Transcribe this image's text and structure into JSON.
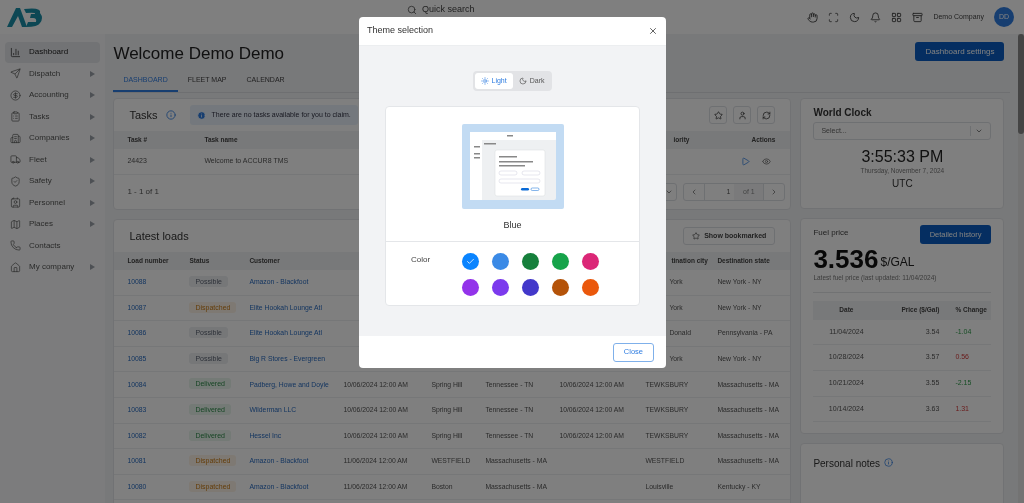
{
  "topbar": {
    "search_placeholder": "Quick search",
    "company": "Demo Company",
    "avatar": "DD"
  },
  "sidebar": {
    "items": [
      {
        "label": "Dashboard",
        "selected": true,
        "has_submenu": false
      },
      {
        "label": "Dispatch",
        "selected": false,
        "has_submenu": true
      },
      {
        "label": "Accounting",
        "selected": false,
        "has_submenu": true
      },
      {
        "label": "Tasks",
        "selected": false,
        "has_submenu": true
      },
      {
        "label": "Companies",
        "selected": false,
        "has_submenu": true
      },
      {
        "label": "Fleet",
        "selected": false,
        "has_submenu": true
      },
      {
        "label": "Safety",
        "selected": false,
        "has_submenu": true
      },
      {
        "label": "Personnel",
        "selected": false,
        "has_submenu": true
      },
      {
        "label": "Places",
        "selected": false,
        "has_submenu": true
      },
      {
        "label": "Contacts",
        "selected": false,
        "has_submenu": false
      },
      {
        "label": "My company",
        "selected": false,
        "has_submenu": true
      }
    ]
  },
  "page": {
    "title": "Welcome Demo Demo",
    "settings_button": "Dashboard settings",
    "tabs": [
      {
        "label": "DASHBOARD",
        "selected": true
      },
      {
        "label": "FLEET MAP",
        "selected": false
      },
      {
        "label": "CALENDAR",
        "selected": false
      }
    ]
  },
  "tasks": {
    "title": "Tasks",
    "alert": "There are no tasks available for you to claim.",
    "columns": [
      "Task #",
      "Task name"
    ],
    "columns_right": [
      "iority",
      "Actions"
    ],
    "rows": [
      {
        "number": "24423",
        "name": "Welcome to ACCUR8 TMS"
      }
    ],
    "range": "1 - 1 of 1",
    "page": "1",
    "page_of": "of 1"
  },
  "loads": {
    "title": "Latest loads",
    "bookmark_button": "Show bookmarked",
    "columns": [
      "Load number",
      "Status",
      "Customer"
    ],
    "columns_right": [
      "tination city",
      "Destination state"
    ],
    "rows": [
      {
        "load": "10088",
        "status": "Possible",
        "kind": "possible",
        "customer": "Amazon - Blackfoot",
        "dest_city": "York",
        "dest_state": "New York - NY"
      },
      {
        "load": "10087",
        "status": "Dispatched",
        "kind": "dispatched",
        "customer": "Elite Hookah Lounge Atl",
        "dest_city": "York",
        "dest_state": "New York - NY"
      },
      {
        "load": "10086",
        "status": "Possible",
        "kind": "possible",
        "customer": "Elite Hookah Lounge Atl",
        "dest_city": "Donald",
        "dest_state": "Pennsylvania - PA"
      },
      {
        "load": "10085",
        "status": "Possible",
        "kind": "possible",
        "customer": "Big R Stores - Evergreen",
        "dest_city": "York",
        "dest_state": "New York - NY"
      },
      {
        "load": "10084",
        "status": "Delivered",
        "kind": "delivered",
        "customer": "Padberg, Howe and Doyle",
        "pickup": "10/06/2024 12:00 AM",
        "origin_city": "Spring Hill",
        "origin_state": "Tennessee - TN",
        "delivery": "10/06/2024 12:00 AM",
        "dest_city": "TEWKSBURY",
        "dest_state": "Massachusetts - MA"
      },
      {
        "load": "10083",
        "status": "Delivered",
        "kind": "delivered",
        "customer": "Wilderman LLC",
        "pickup": "10/06/2024 12:00 AM",
        "origin_city": "Spring Hill",
        "origin_state": "Tennessee - TN",
        "delivery": "10/06/2024 12:00 AM",
        "dest_city": "TEWKSBURY",
        "dest_state": "Massachusetts - MA"
      },
      {
        "load": "10082",
        "status": "Delivered",
        "kind": "delivered",
        "customer": "Hessel Inc",
        "pickup": "10/06/2024 12:00 AM",
        "origin_city": "Spring Hill",
        "origin_state": "Tennessee - TN",
        "delivery": "10/06/2024 12:00 AM",
        "dest_city": "TEWKSBURY",
        "dest_state": "Massachusetts - MA"
      },
      {
        "load": "10081",
        "status": "Dispatched",
        "kind": "dispatched",
        "customer": "Amazon - Blackfoot",
        "pickup": "11/06/2024 12:00 AM",
        "origin_city": "WESTFIELD",
        "origin_state": "Massachusetts - MA",
        "dest_city": "WESTFIELD",
        "dest_state": "Massachusetts - MA"
      },
      {
        "load": "10080",
        "status": "Dispatched",
        "kind": "dispatched",
        "customer": "Amazon - Blackfoot",
        "pickup": "11/06/2024 12:00 AM",
        "origin_city": "Boston",
        "origin_state": "Massachusetts - MA",
        "dest_city": "Louisville",
        "dest_state": "Kentucky - KY"
      }
    ]
  },
  "world_clock": {
    "title": "World Clock",
    "placeholder": "Select...",
    "time": "3:55:33 PM",
    "date": "Thursday, November 7, 2024",
    "zone": "UTC"
  },
  "fuel": {
    "title": "Fuel price",
    "button": "Detailed history",
    "price": "3.536",
    "unit": "$/GAL",
    "note": "Latest fuel price (last updated: 11/04/2024)",
    "columns": [
      "Date",
      "Price ($/Gal)",
      "% Change"
    ],
    "rows": [
      {
        "date": "11/04/2024",
        "price": "3.54",
        "change": "-1.04",
        "kind": "down"
      },
      {
        "date": "10/28/2024",
        "price": "3.57",
        "change": "0.56",
        "kind": "up"
      },
      {
        "date": "10/21/2024",
        "price": "3.55",
        "change": "-2.15",
        "kind": "down"
      },
      {
        "date": "10/14/2024",
        "price": "3.63",
        "change": "1.31",
        "kind": "up"
      }
    ]
  },
  "notes": {
    "title": "Personal notes"
  },
  "modal": {
    "title": "Theme selection",
    "modes": [
      {
        "label": "Light",
        "selected": true
      },
      {
        "label": "Dark",
        "selected": false
      }
    ],
    "theme_name": "Blue",
    "color_label": "Color",
    "colors": [
      {
        "color": "#0a84ff",
        "selected": true
      },
      {
        "color": "#3b8ae6",
        "selected": false
      },
      {
        "color": "#16803c",
        "selected": false
      },
      {
        "color": "#16a34a",
        "selected": false
      },
      {
        "color": "#db2777",
        "selected": false
      },
      {
        "color": "#9333ea",
        "selected": false
      },
      {
        "color": "#7c3aed",
        "selected": false
      },
      {
        "color": "#4338ca",
        "selected": false
      },
      {
        "color": "#b45309",
        "selected": false
      },
      {
        "color": "#ea580c",
        "selected": false
      }
    ],
    "close": "Close"
  }
}
